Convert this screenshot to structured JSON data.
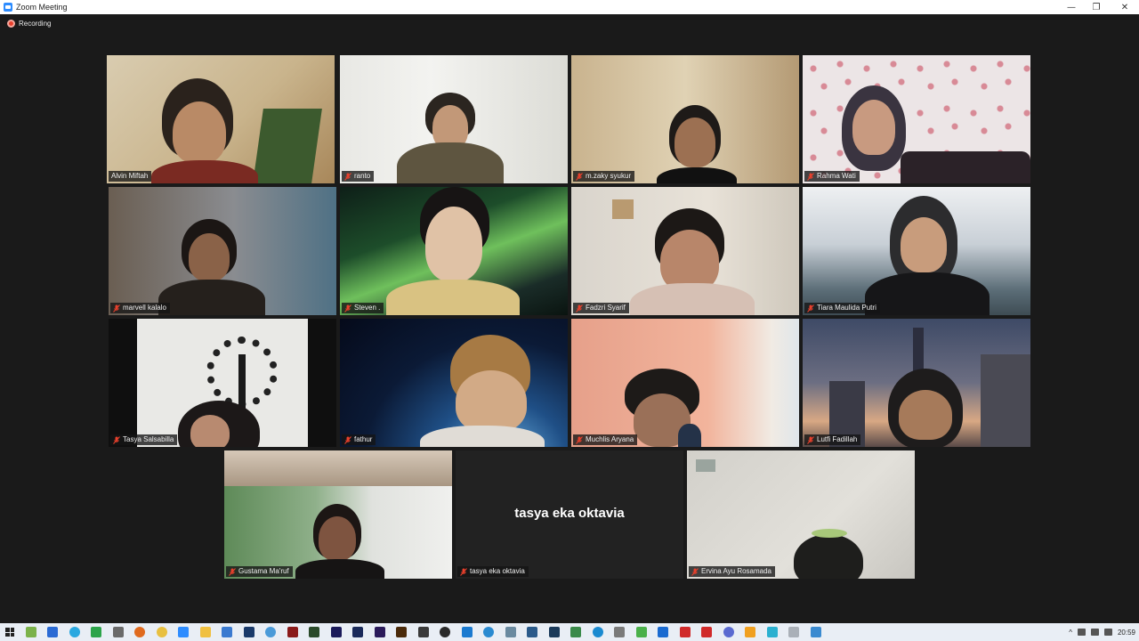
{
  "window": {
    "title": "Zoom Meeting",
    "minimize": "—",
    "restore": "❐",
    "close": "✕"
  },
  "recording": {
    "label": "Recording"
  },
  "participants": [
    {
      "name": "Alvin Miftah",
      "muted": false,
      "active": true
    },
    {
      "name": "ranto",
      "muted": true
    },
    {
      "name": "m.zaky syukur",
      "muted": true
    },
    {
      "name": "Rahma Wati",
      "muted": true
    },
    {
      "name": "marvell kalalo",
      "muted": true
    },
    {
      "name": "Steven .",
      "muted": true
    },
    {
      "name": "Fadzri Syarif",
      "muted": true
    },
    {
      "name": "Tiara Maulida Putri",
      "muted": true
    },
    {
      "name": "Tasya Salsabilla",
      "muted": true
    },
    {
      "name": "fathur",
      "muted": true
    },
    {
      "name": "Muchlis Aryana",
      "muted": true
    },
    {
      "name": "Lutfi Fadillah",
      "muted": true
    },
    {
      "name": "Gustama Ma'ruf",
      "muted": true
    },
    {
      "name": "tasya eka oktavia",
      "muted": true,
      "video_off": true
    },
    {
      "name": "Ervina Ayu Rosamada",
      "muted": true
    }
  ],
  "colors": {
    "active_speaker": "#b8e34a",
    "muted_icon": "#e8402c",
    "recording": "#e8402c"
  },
  "taskbar": {
    "clock": "20:59",
    "tray_chevron": "^"
  }
}
